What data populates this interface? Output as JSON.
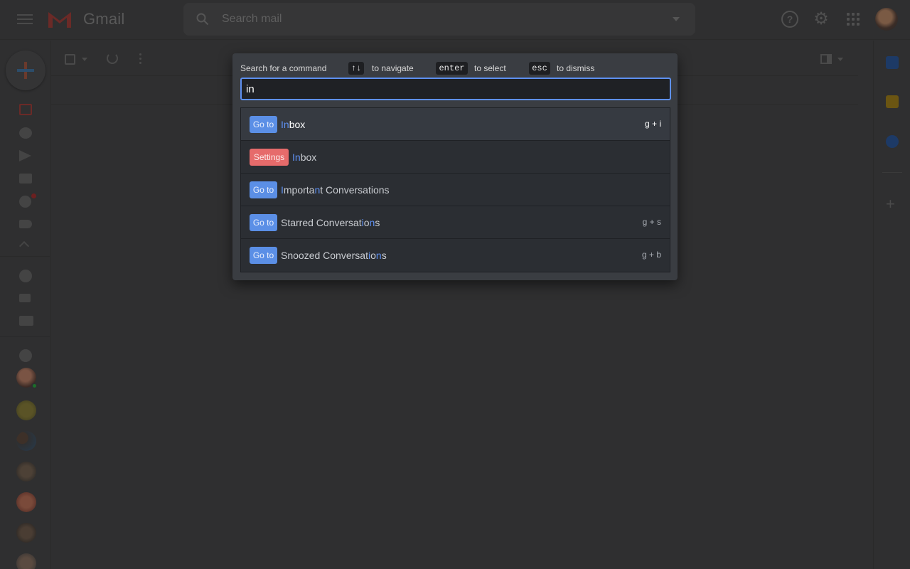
{
  "app": {
    "logo_text": "Gmail"
  },
  "search": {
    "placeholder": "Search mail"
  },
  "icons": {
    "menu": "menu-icon",
    "search": "search-icon",
    "help": "help-icon",
    "settings": "gear-icon",
    "apps": "apps-grid-icon"
  },
  "palette": {
    "title": "Search for a command",
    "hints": [
      {
        "key": "↑↓",
        "text": "to navigate"
      },
      {
        "key": "enter",
        "text": "to select"
      },
      {
        "key": "esc",
        "text": "to dismiss"
      }
    ],
    "query": "in",
    "highlight_color": "#5e90f1",
    "results": [
      {
        "badge": "Go to",
        "badge_color": "#5b8fe6",
        "label_hl": "In",
        "label_rest": "box",
        "shortcut": "g + i",
        "selected": true
      },
      {
        "badge": "Settings",
        "badge_color": "#e66b6b",
        "label_hl": "In",
        "label_rest": "box",
        "shortcut": ""
      },
      {
        "badge": "Go to",
        "badge_color": "#5b8fe6",
        "label_a": "I",
        "label_b": "mporta",
        "label_c": "n",
        "label_d": "t Conversations",
        "shortcut": ""
      },
      {
        "badge": "Go to",
        "badge_color": "#5b8fe6",
        "label_a": "Starred Conversat",
        "label_b": "i",
        "label_c": "o",
        "label_d": "n",
        "label_e": "s",
        "shortcut": "g + s"
      },
      {
        "badge": "Go to",
        "badge_color": "#5b8fe6",
        "label_a": "Snoozed Conversat",
        "label_b": "i",
        "label_c": "o",
        "label_d": "n",
        "label_e": "s",
        "shortcut": "g + b"
      }
    ]
  }
}
